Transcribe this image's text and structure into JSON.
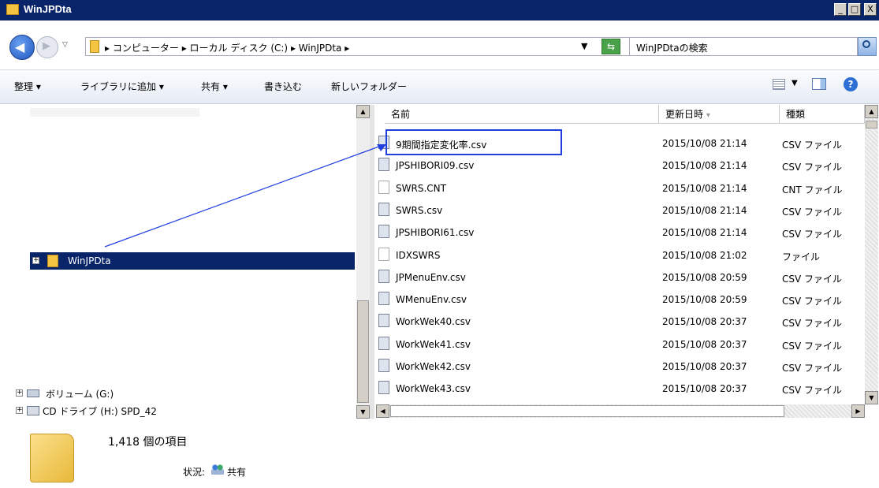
{
  "window": {
    "title": "WinJPDta",
    "min": "_",
    "max": "□",
    "close": "X"
  },
  "address": {
    "crumbs": [
      "コンピューター",
      "ローカル ディスク (C:)",
      "WinJPDta"
    ],
    "search_placeholder": "WinJPDtaの検索"
  },
  "toolbar": {
    "organize": "整理 ▾",
    "add_library": "ライブラリに追加 ▾",
    "share": "共有 ▾",
    "burn": "書き込む",
    "new_folder": "新しいフォルダー"
  },
  "nav": {
    "selected": "WinJPDta",
    "volume": "ボリューム (G:)",
    "cd": "CD ドライブ (H:) SPD_42"
  },
  "columns": {
    "name": "名前",
    "date": "更新日時",
    "type": "種類"
  },
  "files": [
    {
      "name": "9期間指定変化率.csv",
      "date": "2015/10/08 21:14",
      "type": "CSV ファイル",
      "icon": "csv-file-icon"
    },
    {
      "name": "JPSHIBORI09.csv",
      "date": "2015/10/08 21:14",
      "type": "CSV ファイル",
      "icon": "csv-file-icon"
    },
    {
      "name": "SWRS.CNT",
      "date": "2015/10/08 21:14",
      "type": "CNT ファイル",
      "icon": "blank-file-icon"
    },
    {
      "name": "SWRS.csv",
      "date": "2015/10/08 21:14",
      "type": "CSV ファイル",
      "icon": "csv-file-icon"
    },
    {
      "name": "JPSHIBORI61.csv",
      "date": "2015/10/08 21:14",
      "type": "CSV ファイル",
      "icon": "csv-file-icon"
    },
    {
      "name": "IDXSWRS",
      "date": "2015/10/08 21:02",
      "type": "ファイル",
      "icon": "blank-file-icon"
    },
    {
      "name": "JPMenuEnv.csv",
      "date": "2015/10/08 20:59",
      "type": "CSV ファイル",
      "icon": "csv-file-icon"
    },
    {
      "name": "WMenuEnv.csv",
      "date": "2015/10/08 20:59",
      "type": "CSV ファイル",
      "icon": "csv-file-icon"
    },
    {
      "name": "WorkWek40.csv",
      "date": "2015/10/08 20:37",
      "type": "CSV ファイル",
      "icon": "csv-file-icon"
    },
    {
      "name": "WorkWek41.csv",
      "date": "2015/10/08 20:37",
      "type": "CSV ファイル",
      "icon": "csv-file-icon"
    },
    {
      "name": "WorkWek42.csv",
      "date": "2015/10/08 20:37",
      "type": "CSV ファイル",
      "icon": "csv-file-icon"
    },
    {
      "name": "WorkWek43.csv",
      "date": "2015/10/08 20:37",
      "type": "CSV ファイル",
      "icon": "csv-file-icon"
    }
  ],
  "details": {
    "count": "1,418 個の項目",
    "status_label": "状況:",
    "status_value": "共有"
  },
  "colors": {
    "titlebar": "#0a246a",
    "selection": "#0a246a",
    "annotation": "#1f3fe0"
  }
}
